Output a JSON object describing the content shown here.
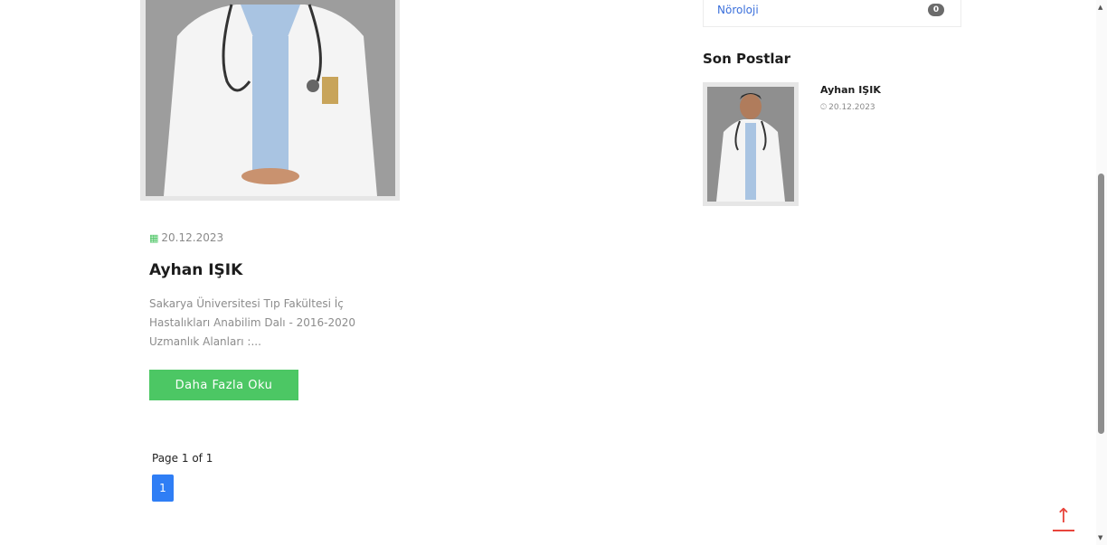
{
  "post": {
    "date": "20.12.2023",
    "title": "Ayhan IŞIK",
    "excerpt": "Sakarya Üniversitesi Tıp Fakültesi İç Hastalıkları Anabilim Dalı - 2016-2020 Uzmanlık Alanları :...",
    "read_more": "Daha Fazla Oku",
    "image_alt": "Doctor in white coat with stethoscope"
  },
  "pagination": {
    "info": "Page 1 of 1",
    "current": "1"
  },
  "sidebar": {
    "category": {
      "name": "Nöroloji",
      "count": "0"
    },
    "recent_heading": "Son Postlar",
    "recent_posts": [
      {
        "title": "Ayhan IŞIK",
        "date": "20.12.2023"
      }
    ]
  },
  "icons": {
    "calendar": "calendar-icon",
    "clock": "clock-icon",
    "back_to_top": "arrow-up-icon"
  },
  "colors": {
    "accent_green": "#4cc764",
    "link_blue": "#3a6fdb",
    "page_blue": "#2f7ef5",
    "back_to_top_red": "#e8453c"
  }
}
